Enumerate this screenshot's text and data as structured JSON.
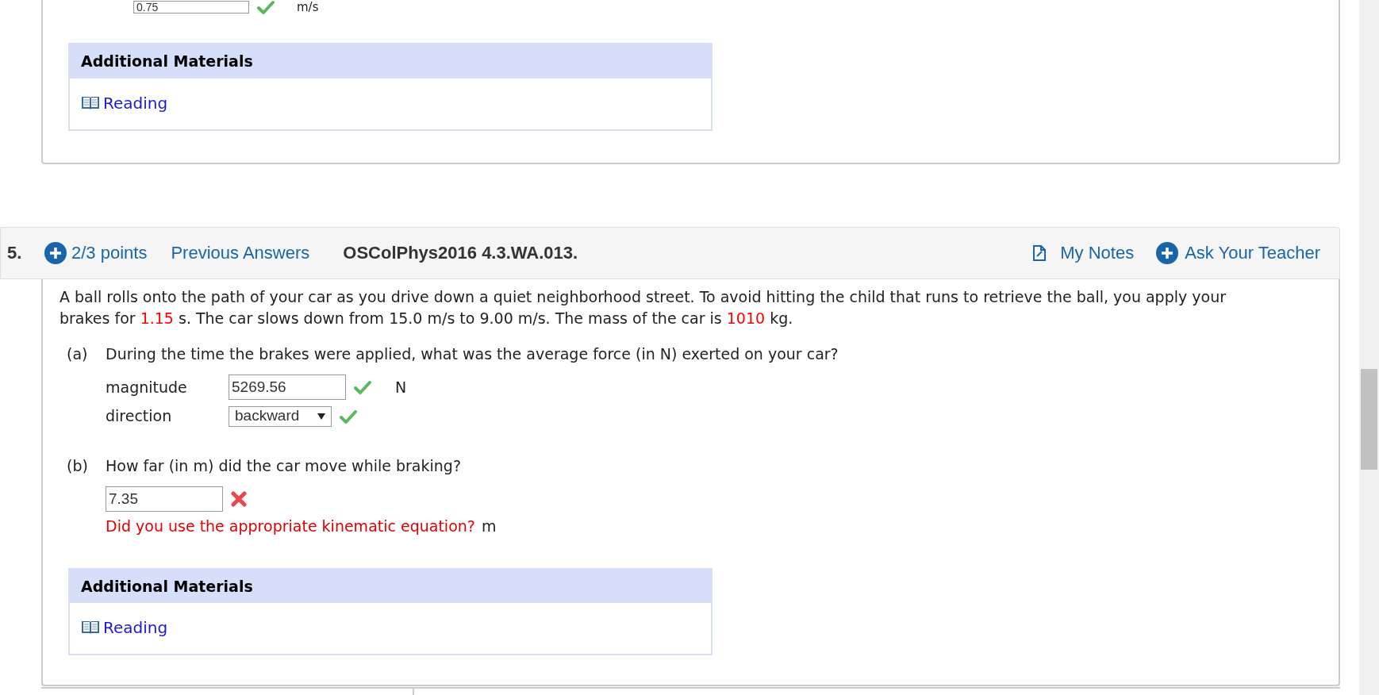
{
  "previous_question": {
    "answer": {
      "value": "0.75",
      "correct": true,
      "unit": "m/s"
    },
    "materials": {
      "title": "Additional Materials",
      "links": [
        "Reading"
      ]
    }
  },
  "question": {
    "number": "5.",
    "points": "2/3 points",
    "previous_answers": "Previous Answers",
    "code": "OSColPhys2016 4.3.WA.013.",
    "notes": "My Notes",
    "ask": "Ask Your Teacher",
    "text": [
      {
        "text": "A ball rolls onto the path of your car as you drive down a quiet neighborhood street. To avoid hitting the child that runs to retrieve the ball, you apply your brakes for ",
        "highlight": false
      },
      {
        "text": "1.15",
        "highlight": true
      },
      {
        "text": " s. The car slows down from 15.0 m/s to 9.00 m/s. The mass of the car is ",
        "highlight": false
      },
      {
        "text": "1010",
        "highlight": true
      },
      {
        "text": " kg.",
        "highlight": false
      }
    ],
    "parts": [
      {
        "label": "(a)",
        "prompt": "During the time the brakes were applied, what was the average force (in N) exerted on your car?",
        "fields": [
          {
            "kind": "input",
            "label": "magnitude",
            "value": "5269.56",
            "correct": true,
            "unit": "N"
          },
          {
            "kind": "select",
            "label": "direction",
            "value": "backward",
            "correct": true
          }
        ]
      },
      {
        "label": "(b)",
        "prompt": "How far (in m) did the car move while braking?",
        "fields": [
          {
            "kind": "input",
            "value": "7.35",
            "correct": false,
            "feedback": "Did you use the appropriate kinematic equation?",
            "unit": "m"
          }
        ]
      }
    ],
    "materials": {
      "title": "Additional Materials",
      "links": [
        "Reading"
      ]
    }
  }
}
